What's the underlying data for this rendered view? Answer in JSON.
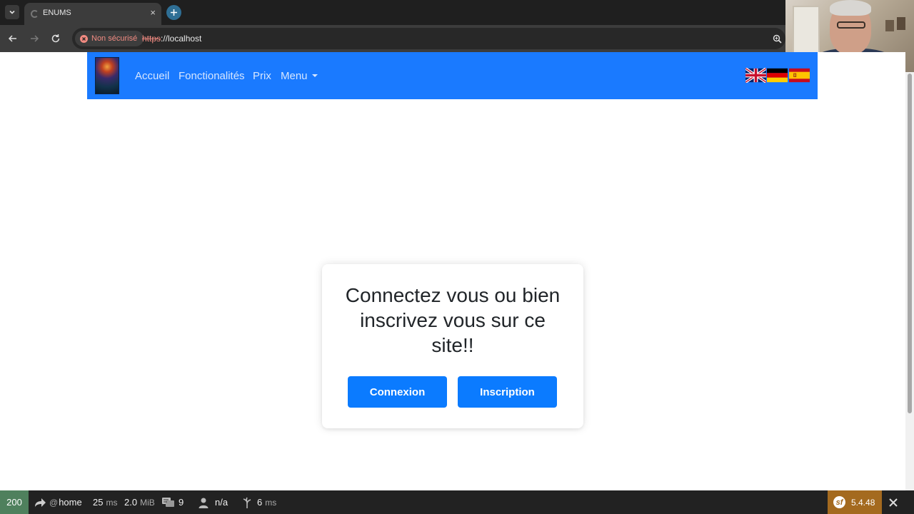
{
  "browser": {
    "tab": {
      "title": "ENUMS",
      "close": "×"
    },
    "newtab": "+",
    "security_label": "Non sécurisé",
    "url_scheme": "https",
    "url_rest": "://localhost"
  },
  "navbar": {
    "links": [
      "Accueil",
      "Fonctionalités",
      "Prix",
      "Menu"
    ],
    "flags": [
      "uk-flag-icon",
      "germany-flag-icon",
      "spain-flag-icon"
    ],
    "color": "#1a7aff"
  },
  "card": {
    "title": "Connectez vous ou bien inscrivez vous sur ce site!!",
    "login_label": "Connexion",
    "register_label": "Inscription",
    "button_color": "#0b7bff"
  },
  "toolbar": {
    "status": "200",
    "route_prefix": "@",
    "route": "home",
    "time_value": "25",
    "time_unit": "ms",
    "memory_value": "2.0",
    "memory_unit": "MiB",
    "logs": "9",
    "user": "n/a",
    "twig_value": "6",
    "twig_unit": "ms",
    "version": "5.4.48",
    "status_color": "#4f805d",
    "version_color": "#a46a1f"
  }
}
